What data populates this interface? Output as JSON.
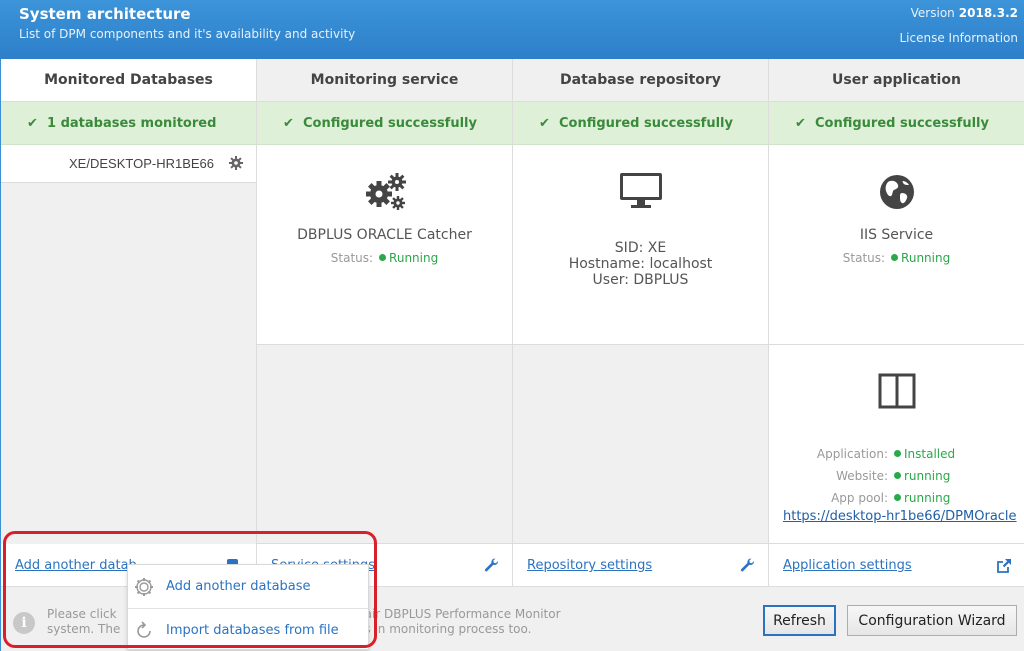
{
  "header": {
    "title": "System architecture",
    "subtitle": "List of DPM components and it's availability and activity",
    "version_label": "Version",
    "version_value": "2018.3.2",
    "license_link": "License Information"
  },
  "columns": {
    "databases": {
      "heading": "Monitored Databases",
      "status": "1 databases  monitored",
      "items": [
        {
          "name": "XE/DESKTOP-HR1BE66"
        }
      ],
      "footer_link": "Add another datab"
    },
    "monitoring": {
      "heading": "Monitoring service",
      "status": "Configured successfully",
      "service_name": "DBPLUS ORACLE Catcher",
      "status_label": "Status:",
      "status_value": "Running",
      "footer_link": "Service settings"
    },
    "repository": {
      "heading": "Database repository",
      "status": "Configured successfully",
      "sid": "SID: XE",
      "hostname": "Hostname: localhost",
      "user": "User: DBPLUS",
      "footer_link": "Repository settings"
    },
    "user_app": {
      "heading": "User application",
      "status": "Configured successfully",
      "service_name": "IIS Service",
      "status_label": "Status:",
      "status_value": "Running",
      "application_label": "Application:",
      "application_value": "Installed",
      "website_label": "Website:",
      "website_value": "running",
      "apppool_label": "App pool:",
      "apppool_value": "running",
      "app_url": "https://desktop-hr1be66/DPMOracle",
      "footer_link": "Application settings"
    }
  },
  "info": {
    "line1_left": "Please click",
    "line2_left": "system. The",
    "line1_right": "pair DBPLUS Performance Monitor",
    "line2_right": "es in monitoring process too."
  },
  "buttons": {
    "refresh": "Refresh",
    "wizard": "Configuration Wizard"
  },
  "dropdown": {
    "items": [
      {
        "label": "Add another database",
        "icon": "gear-icon"
      },
      {
        "label": "Import databases from file",
        "icon": "refresh-icon"
      }
    ]
  },
  "colors": {
    "accent": "#2b73c0",
    "success": "#2aa84a",
    "highlight": "#d8202a"
  }
}
